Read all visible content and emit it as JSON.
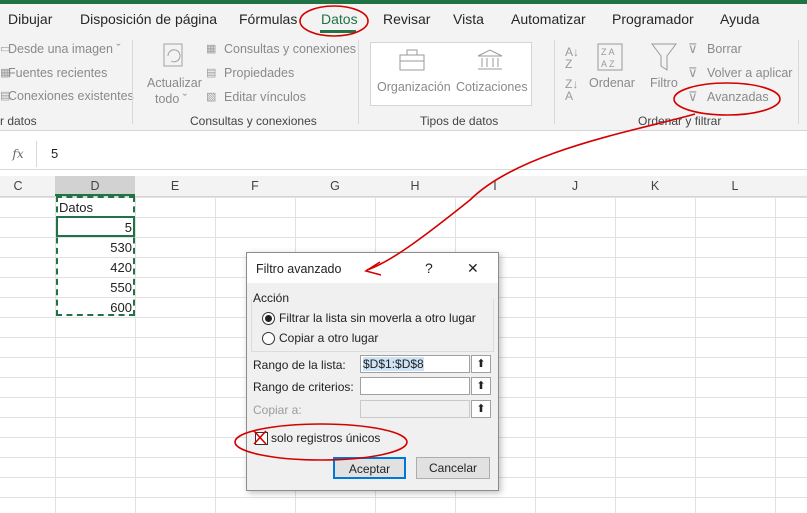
{
  "menu": {
    "tabs": [
      "Dibujar",
      "Disposición de página",
      "Fórmulas",
      "Datos",
      "Revisar",
      "Vista",
      "Automatizar",
      "Programador",
      "Ayuda"
    ],
    "active": "Datos"
  },
  "ribbon": {
    "get_data": {
      "items": [
        "Desde una imagen ˇ",
        "Fuentes recientes",
        "Conexiones existentes"
      ],
      "group_label": "r datos"
    },
    "queries": {
      "refresh_label_1": "Actualizar",
      "refresh_label_2": "todo ˇ",
      "items": [
        "Consultas y conexiones",
        "Propiedades",
        "Editar vínculos"
      ],
      "group_label": "Consultas y conexiones"
    },
    "data_types": {
      "items": [
        "Organización",
        "Cotizaciones"
      ],
      "group_label": "Tipos de datos"
    },
    "sort_filter": {
      "sort_label": "Ordenar",
      "filter_label": "Filtro",
      "items": [
        "Borrar",
        "Volver a aplicar",
        "Avanzadas"
      ],
      "group_label": "Ordenar y filtrar"
    }
  },
  "formula_bar": {
    "fx": "fx",
    "value": "5"
  },
  "columns": [
    "C",
    "D",
    "E",
    "F",
    "G",
    "H",
    "I",
    "J",
    "K",
    "L"
  ],
  "sheet": {
    "header": "Datos",
    "values": [
      "5",
      "530",
      "420",
      "550",
      "600"
    ]
  },
  "dialog": {
    "title": "Filtro avanzado",
    "help": "?",
    "close": "✕",
    "section": "Acción",
    "option_filter": "Filtrar la lista sin moverla a otro lugar",
    "option_copy": "Copiar a otro lugar",
    "range_label": "Rango de la lista:",
    "range_value": "$D$1:$D$8",
    "criteria_label": "Rango de criterios:",
    "copy_to_label": "Copiar a:",
    "unique_label": "solo registros únicos",
    "ok": "Aceptar",
    "cancel": "Cancelar"
  }
}
